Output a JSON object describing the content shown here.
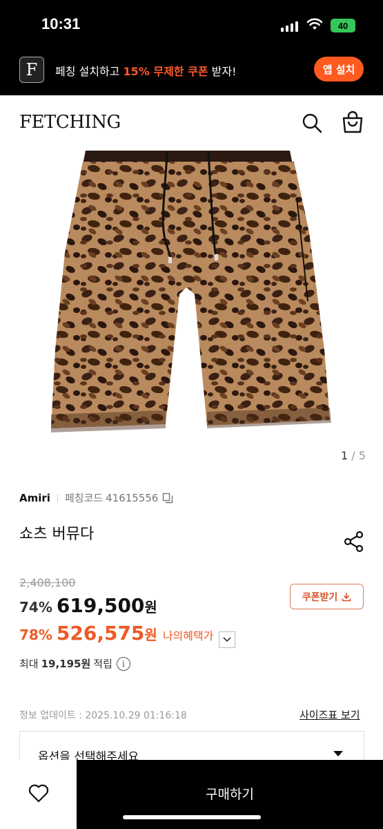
{
  "status": {
    "time": "10:31",
    "battery": "40"
  },
  "promo": {
    "logo_letter": "F",
    "text_prefix": "페칭 설치하고 ",
    "text_highlight": "15% 무제한 쿠폰",
    "text_suffix": " 받자!",
    "button": "앱 설치"
  },
  "header": {
    "logo": "FETCHING",
    "search_icon": "search-icon",
    "bag_icon": "shopping-bag-icon"
  },
  "image": {
    "current": "1",
    "separator": "/",
    "total": "5"
  },
  "product": {
    "brand": "Amiri",
    "code_label": "페칭코드",
    "code_value": "41615556",
    "name": "쇼츠 버뮤다",
    "original_price": "2,408,100",
    "discount": "74%",
    "price": "619,500",
    "currency": "원",
    "coupon_button": "쿠폰받기",
    "benefit_discount": "78%",
    "benefit_price": "526,575",
    "benefit_label": "나의혜택가",
    "points_prefix": "최대",
    "points_value": "19,195원",
    "points_suffix": "적립",
    "update_label": "정보 업데이트 : 2025.10.29 01:16:18",
    "size_chart_link": "사이즈표 보기",
    "option_placeholder": "옵션을 선택해주세요"
  },
  "bottom": {
    "buy_button": "구매하기"
  },
  "colors": {
    "accent": "#ee5a26",
    "promo_button": "#ff5a1f",
    "battery": "#35c759"
  }
}
